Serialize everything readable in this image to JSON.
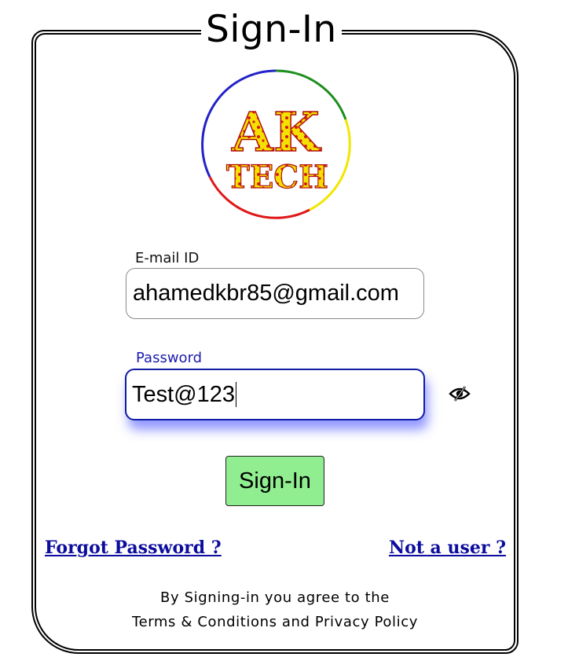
{
  "form": {
    "title": "Sign-In",
    "email": {
      "label": "E-mail ID",
      "value": "ahamedkbr85@gmail.com"
    },
    "password": {
      "label": "Password",
      "value": "Test@123",
      "toggle_icon": "eye-slash-icon"
    },
    "submit_label": "Sign-In",
    "forgot_link": "Forgot Password ?",
    "signup_link": "Not a user ?"
  },
  "logo": {
    "line1": "AK",
    "line2": "TECH",
    "colors": {
      "ring_top": "#1e8e1e",
      "ring_right": "#f2e600",
      "ring_bottom": "#e01818",
      "ring_left": "#2323c8",
      "text_fill": "#f5e100",
      "text_spots": "#d41b1b"
    }
  },
  "footer": {
    "line1": "By Signing-in you agree to the",
    "line2": "Terms & Conditions and Privacy Policy"
  },
  "colors": {
    "accent": "#0f1ca3",
    "button_bg": "#90ee90",
    "link": "#0c0c9e"
  }
}
